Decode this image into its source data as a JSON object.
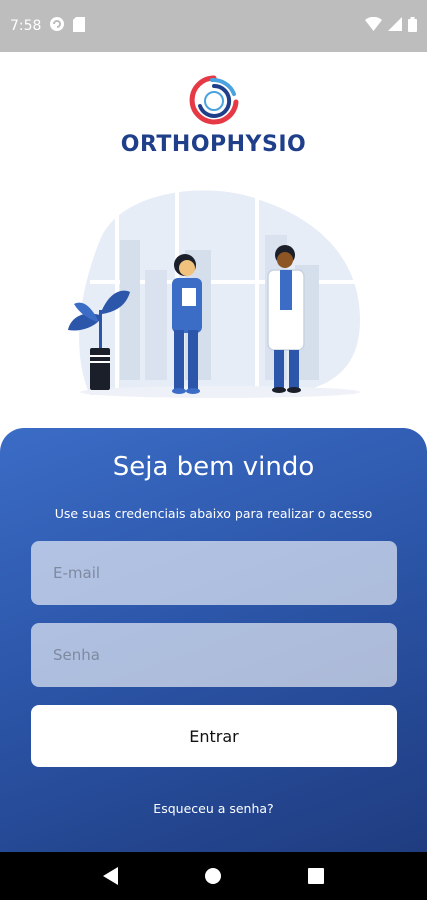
{
  "status_bar": {
    "time": "7:58",
    "icons": [
      "cloud-sync-icon",
      "sd-card-icon",
      "wifi-icon",
      "signal-icon",
      "battery-icon"
    ]
  },
  "logo": {
    "text": "ORTHOPHYSIO",
    "colors": {
      "red": "#e63946",
      "blue": "#1f3f8a",
      "light_blue": "#4aa3df"
    }
  },
  "illustration": {
    "icon": "doctors-illustration"
  },
  "login": {
    "title": "Seja bem vindo",
    "subtitle": "Use suas credenciais abaixo para realizar o acesso",
    "email_placeholder": "E-mail",
    "email_value": "",
    "password_placeholder": "Senha",
    "password_value": "",
    "submit_label": "Entrar",
    "forgot_label": "Esqueceu a senha?",
    "gradient": [
      "#3b6cc6",
      "#1f3c80"
    ]
  },
  "nav_bar": {
    "icons": [
      "back-icon",
      "home-icon",
      "recents-icon"
    ]
  }
}
